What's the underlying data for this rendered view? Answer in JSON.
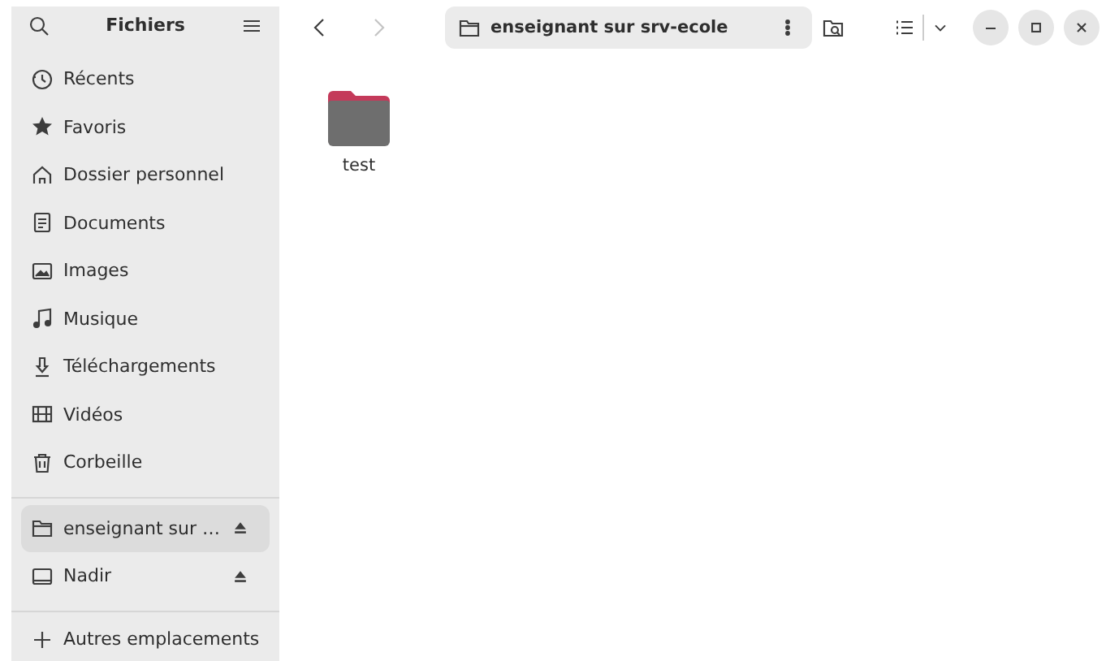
{
  "sidebar": {
    "title": "Fichiers",
    "places": [
      {
        "label": "Récents",
        "selected": false
      },
      {
        "label": "Favoris",
        "selected": false
      },
      {
        "label": "Dossier personnel",
        "selected": false
      },
      {
        "label": "Documents",
        "selected": false
      },
      {
        "label": "Images",
        "selected": false
      },
      {
        "label": "Musique",
        "selected": false
      },
      {
        "label": "Téléchargements",
        "selected": false
      },
      {
        "label": "Vidéos",
        "selected": false
      },
      {
        "label": "Corbeille",
        "selected": false
      }
    ],
    "devices": [
      {
        "label": "enseignant sur …",
        "selected": true
      },
      {
        "label": "Nadir",
        "selected": false
      }
    ],
    "other": {
      "label": "Autres emplacements"
    }
  },
  "toolbar": {
    "back_disabled": false,
    "forward_disabled": true,
    "location": "enseignant sur srv-ecole"
  },
  "files": [
    {
      "name": "test",
      "selected": false
    }
  ]
}
